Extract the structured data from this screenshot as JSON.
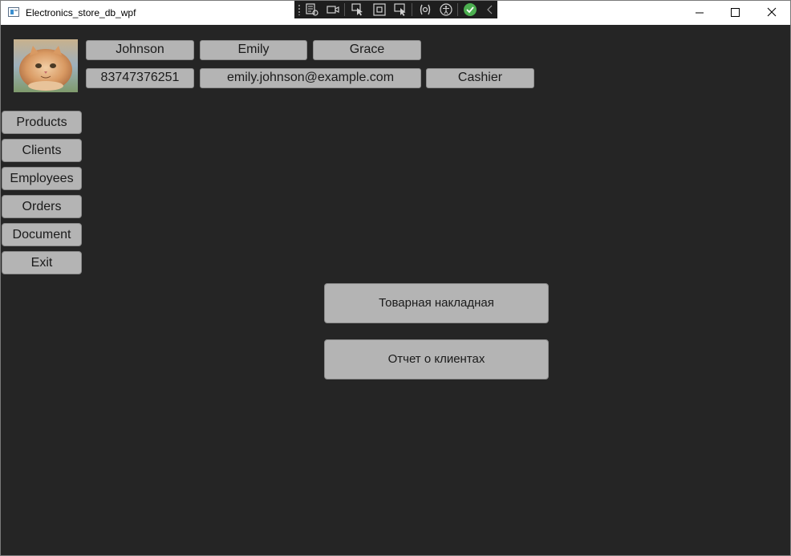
{
  "window": {
    "title": "Electronics_store_db_wpf",
    "minimize_icon": "minimize-icon",
    "maximize_icon": "maximize-icon",
    "close_icon": "close-icon"
  },
  "debug_toolbar": {
    "icons": [
      "select-element-icon",
      "record-icon",
      "pointer-icon",
      "bounds-icon",
      "inspect-icon",
      "binding-icon",
      "accessibility-icon",
      "check-icon",
      "collapse-icon"
    ],
    "check_color": "#4caf50"
  },
  "user": {
    "avatar_icon": "cat-photo",
    "last_name": "Johnson",
    "first_name": "Emily",
    "middle_name": "Grace",
    "phone": "83747376251",
    "email": "emily.johnson@example.com",
    "role": "Cashier"
  },
  "nav": {
    "items": [
      {
        "label": "Products"
      },
      {
        "label": "Clients"
      },
      {
        "label": "Employees"
      },
      {
        "label": "Orders"
      },
      {
        "label": "Document"
      },
      {
        "label": "Exit"
      }
    ]
  },
  "documents": {
    "buttons": [
      {
        "label": "Товарная накладная"
      },
      {
        "label": "Отчет о клиентах"
      }
    ]
  },
  "colors": {
    "background": "#252525",
    "button": "#b4b4b4",
    "titlebar": "#ffffff"
  }
}
